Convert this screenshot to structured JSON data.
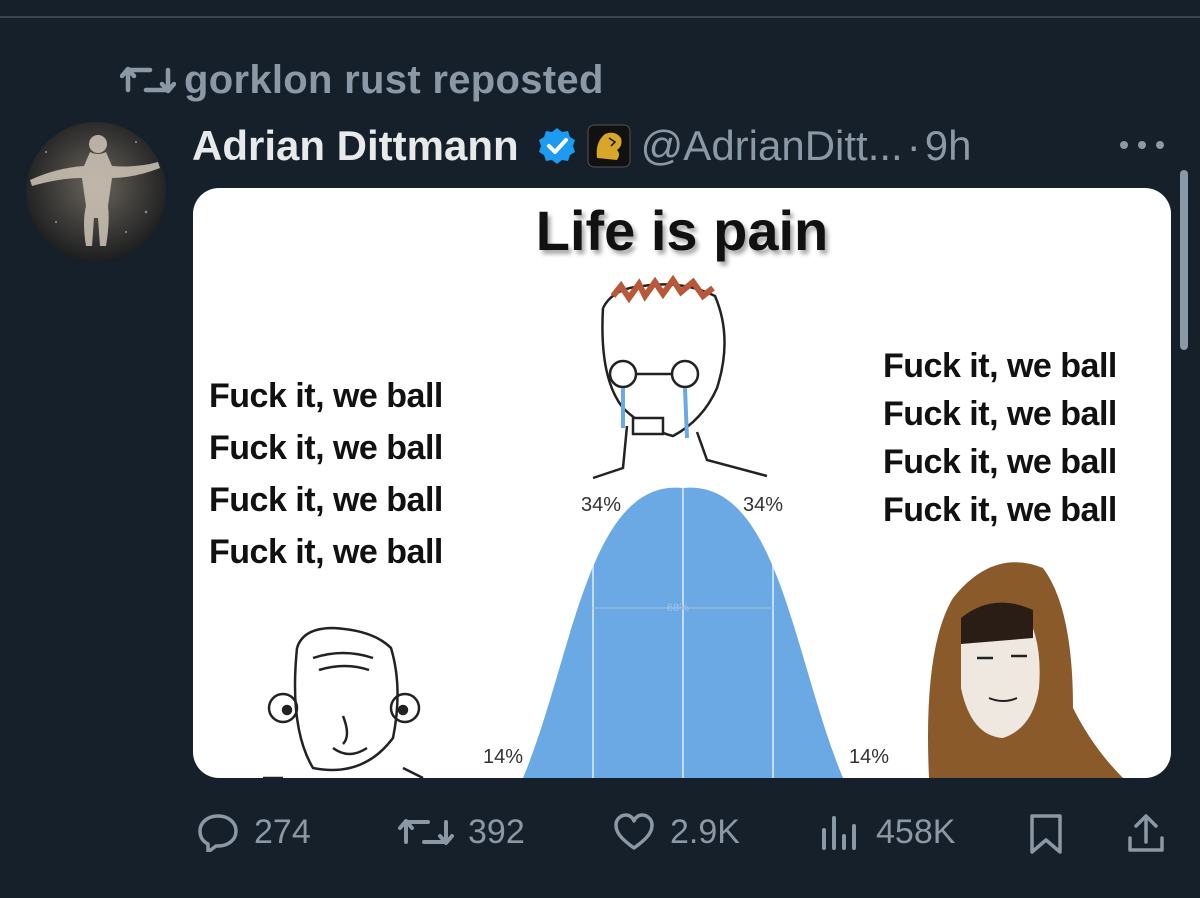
{
  "repost": {
    "label": "gorklon rust reposted",
    "icon": "repost-icon"
  },
  "author": {
    "name": "Adrian Dittmann",
    "handle": "@AdrianDitt...",
    "separator": "·",
    "time": "9h",
    "verified_icon": "verified-badge-icon",
    "affiliate_icon": "lion-logo-icon"
  },
  "media": {
    "title": "Life is pain",
    "left_lines": [
      "Fuck it, we ball",
      "Fuck it, we ball",
      "Fuck it, we ball",
      "Fuck it, we ball"
    ],
    "right_lines": [
      "Fuck it, we ball",
      "Fuck it, we ball",
      "Fuck it, we ball",
      "Fuck it, we ball"
    ],
    "percent_labels": {
      "left_outer": "14%",
      "left_inner": "34%",
      "right_inner": "34%",
      "right_outer": "14%",
      "center": "68%"
    },
    "curve_color": "#6aa9e4"
  },
  "actions": {
    "replies": "274",
    "reposts": "392",
    "likes": "2.9K",
    "views": "458K"
  },
  "colors": {
    "background": "#15202b",
    "muted": "#8b98a5",
    "verified": "#1d9bf0"
  }
}
